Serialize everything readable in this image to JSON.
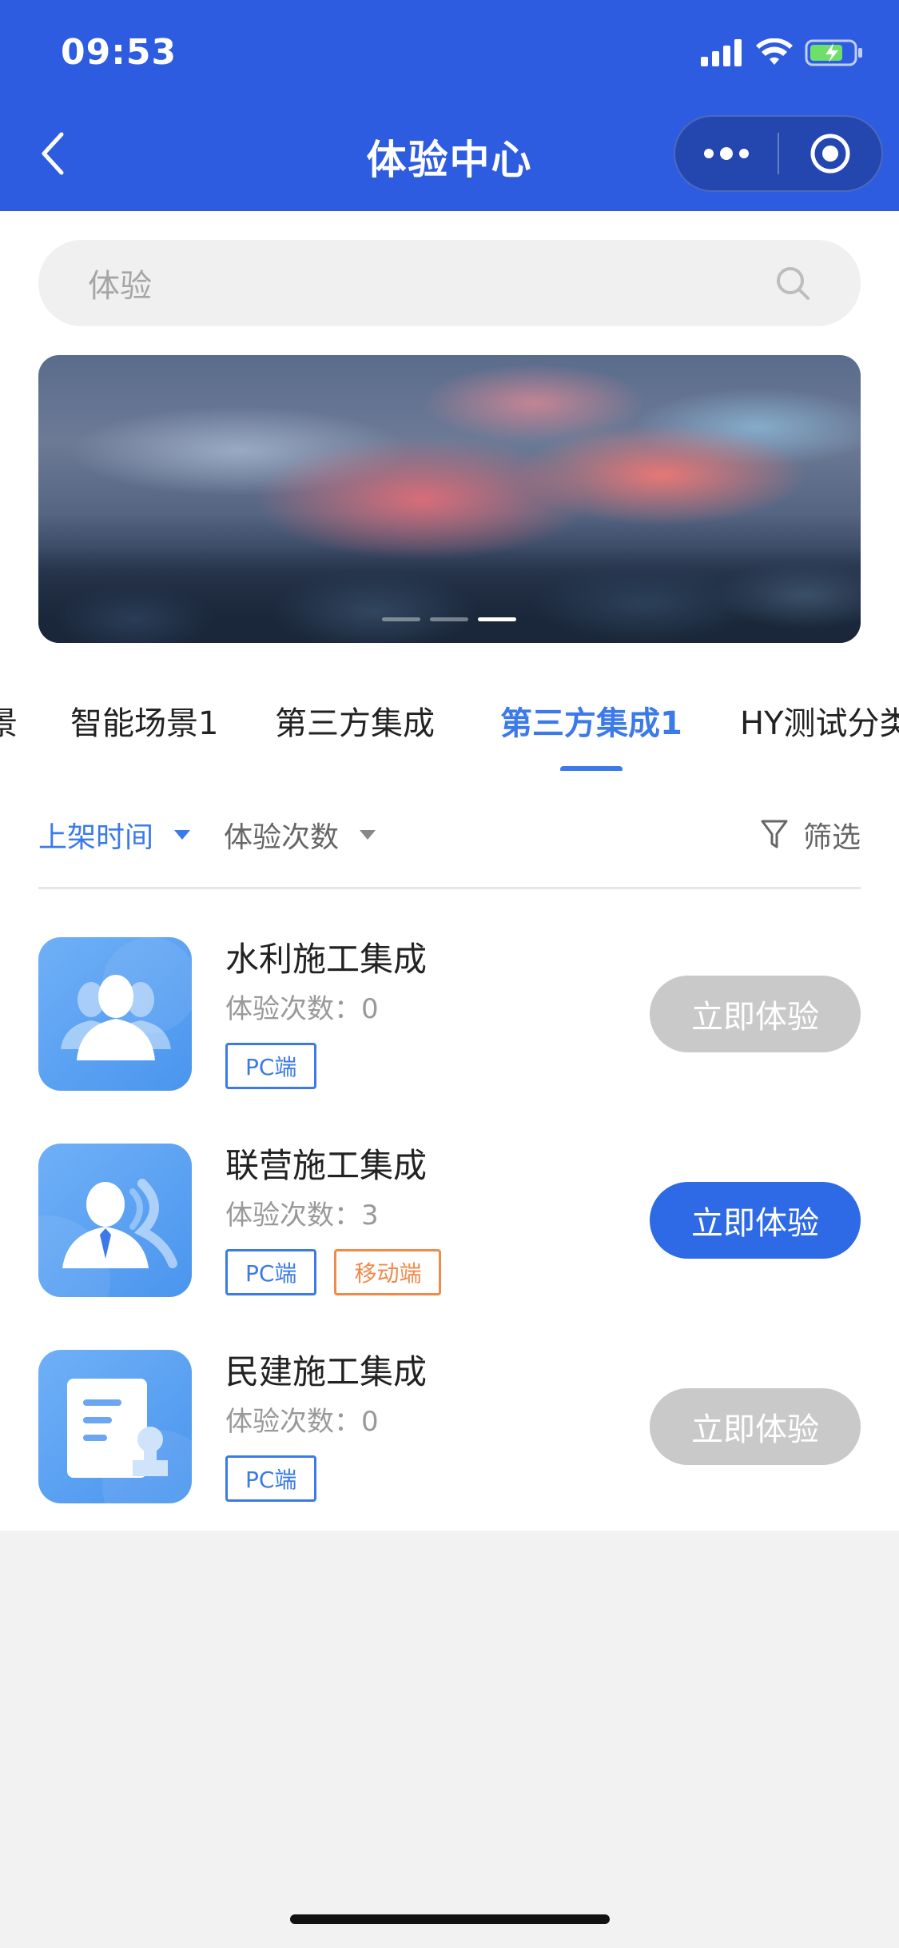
{
  "status_bar": {
    "time": "09:53"
  },
  "nav": {
    "title": "体验中心",
    "back_icon": "chevron-left-icon",
    "more_icon": "more-dots-icon",
    "close_icon": "target-icon"
  },
  "search": {
    "placeholder": "体验",
    "icon": "search-icon"
  },
  "banner": {
    "slides": 3,
    "active_slide": 3
  },
  "tabs": [
    {
      "label": "景"
    },
    {
      "label": "智能场景1"
    },
    {
      "label": "第三方集成"
    },
    {
      "label": "第三方集成1",
      "active": true
    },
    {
      "label": "HY测试分类"
    }
  ],
  "sort": {
    "time_label": "上架时间",
    "count_label": "体验次数",
    "filter_label": "筛选"
  },
  "items": [
    {
      "title": "水利施工集成",
      "count": "体验次数：0",
      "badges": [
        "PC端"
      ],
      "button": "立即体验",
      "enabled": false,
      "icon": "users-group-icon"
    },
    {
      "title": "联营施工集成",
      "count": "体验次数：3",
      "badges": [
        "PC端",
        "移动端"
      ],
      "button": "立即体验",
      "enabled": true,
      "icon": "business-person-icon"
    },
    {
      "title": "民建施工集成",
      "count": "体验次数：0",
      "badges": [
        "PC端"
      ],
      "button": "立即体验",
      "enabled": false,
      "icon": "document-stamp-icon"
    }
  ],
  "colors": {
    "header": "#2e5ce0",
    "accent": "#3b7ae8",
    "button_enabled": "#2e6ae6",
    "button_disabled": "#c9c9c9",
    "badge_orange": "#f08a4b"
  }
}
